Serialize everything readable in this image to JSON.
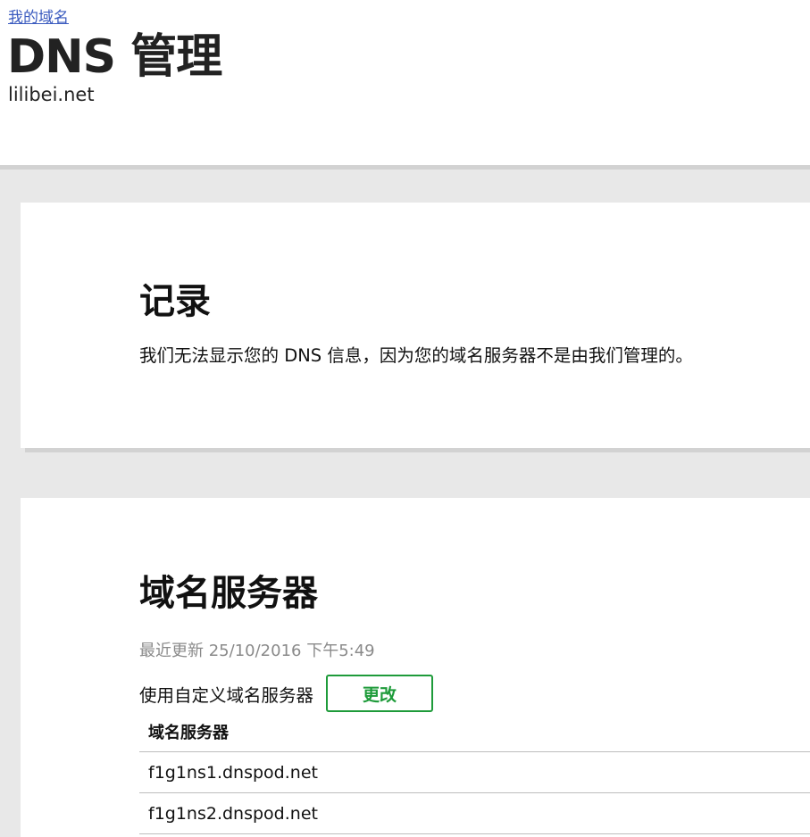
{
  "breadcrumb": {
    "label": "我的域名"
  },
  "header": {
    "title": "DNS 管理",
    "domain": "lilibei.net"
  },
  "records": {
    "heading": "记录",
    "message": "我们无法显示您的 DNS 信息，因为您的域名服务器不是由我们管理的。"
  },
  "nameservers": {
    "heading": "域名服务器",
    "updated": "最近更新 25/10/2016 下午5:49",
    "custom_label": "使用自定义域名服务器",
    "change_label": "更改",
    "column_header": "域名服务器",
    "rows": [
      "f1g1ns1.dnspod.net",
      "f1g1ns2.dnspod.net"
    ]
  },
  "colors": {
    "link": "#3b5bbf",
    "accent_green": "#1e9b3a",
    "muted_text": "#8a8a8a",
    "page_background": "#e8e8e8"
  }
}
